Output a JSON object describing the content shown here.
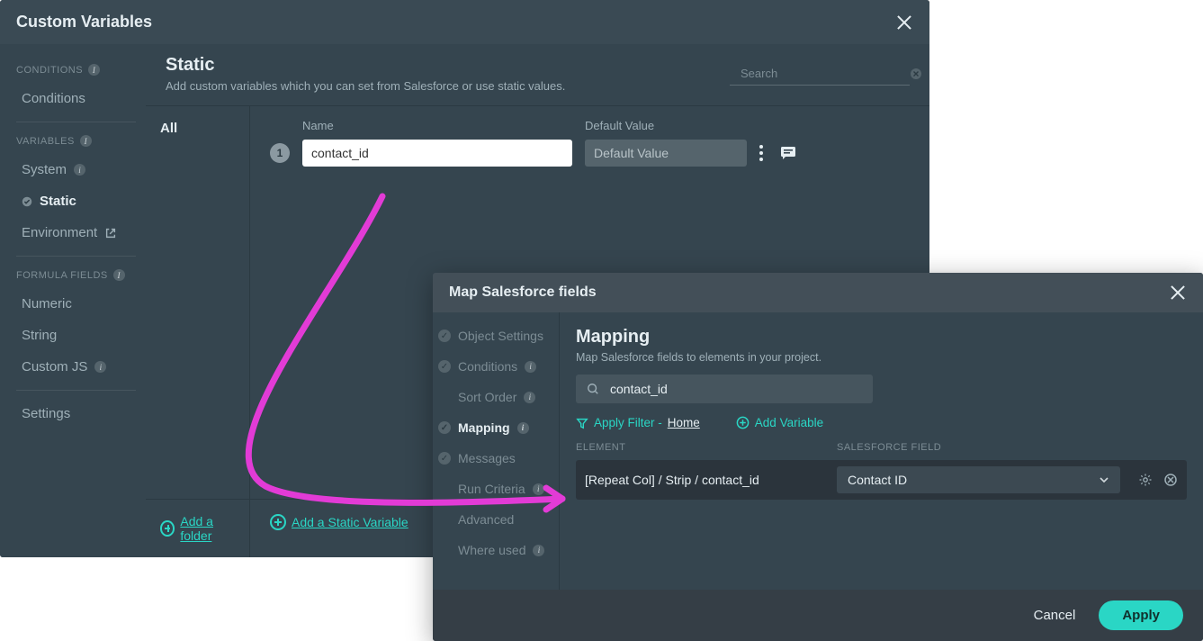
{
  "dialog": {
    "title": "Custom Variables",
    "search_placeholder": "Search"
  },
  "sidebar": {
    "sections": {
      "conditions_label": "CONDITIONS",
      "variables_label": "VARIABLES",
      "formula_label": "FORMULA FIELDS"
    },
    "items": {
      "conditions": "Conditions",
      "system": "System",
      "static": "Static",
      "environment": "Environment",
      "numeric": "Numeric",
      "string": "String",
      "customjs": "Custom JS",
      "settings": "Settings"
    }
  },
  "content": {
    "title": "Static",
    "subtitle": "Add custom variables which you can set from Salesforce or use static values.",
    "tab_all": "All",
    "headers": {
      "name": "Name",
      "default": "Default Value"
    },
    "row": {
      "index": "1",
      "name": "contact_id",
      "default_placeholder": "Default Value"
    },
    "footer": {
      "add_folder": "Add a folder",
      "add_variable": "Add a Static Variable"
    }
  },
  "map": {
    "header": "Map Salesforce fields",
    "nav": {
      "object_settings": "Object Settings",
      "conditions": "Conditions",
      "sort_order": "Sort Order",
      "mapping": "Mapping",
      "messages": "Messages",
      "run_criteria": "Run Criteria",
      "advanced": "Advanced",
      "where_used": "Where used"
    },
    "main": {
      "title": "Mapping",
      "subtitle": "Map Salesforce fields to elements in your project.",
      "search_value": "contact_id",
      "apply_filter_label": "Apply Filter -",
      "apply_filter_home": "Home",
      "add_variable": "Add Variable",
      "col_element": "ELEMENT",
      "col_sf": "SALESFORCE FIELD",
      "row_element": "[Repeat Col] / Strip / contact_id",
      "row_sf_value": "Contact ID"
    },
    "footer": {
      "cancel": "Cancel",
      "apply": "Apply"
    }
  }
}
